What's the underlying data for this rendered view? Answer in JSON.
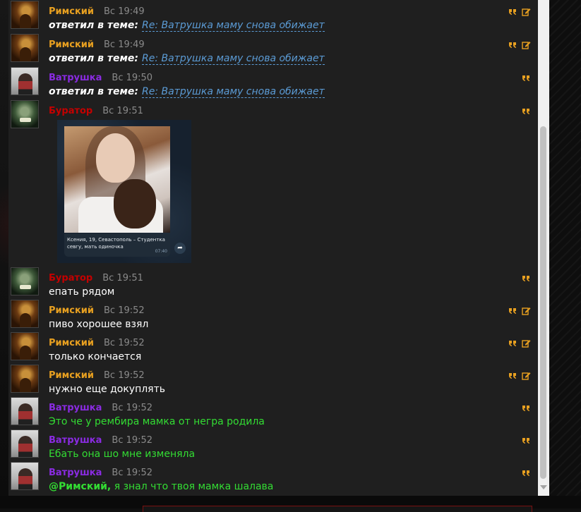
{
  "colors": {
    "rimsky": "#e8a020",
    "vatrushka": "#8a2be2",
    "burator": "#c40000",
    "time": "#8a8a8a",
    "link": "#5b9bd5",
    "green_text": "#33dd33",
    "panel_bg": "#1f1f1f"
  },
  "icons": {
    "quote": "quote-icon",
    "edit": "edit-icon",
    "share": "share-icon"
  },
  "messages": [
    {
      "author": "Римский",
      "time": "Вс 19:49",
      "topic_prefix": "ответил в теме:",
      "topic": "Re: Ватрушка маму снова обижает"
    },
    {
      "author": "Римский",
      "time": "Вс 19:49",
      "topic_prefix": "ответил в теме:",
      "topic": "Re: Ватрушка маму снова обижает"
    },
    {
      "author": "Ватрушка",
      "time": "Вс 19:50",
      "topic_prefix": "ответил в теме:",
      "topic": "Re: Ватрушка маму снова обижает"
    },
    {
      "author": "Буратор",
      "time": "Вс 19:51",
      "image_caption": "Ксения, 19, Севастополь – Студентка севгу, мать одиночка",
      "image_time": "07:40"
    },
    {
      "author": "Буратор",
      "time": "Вс 19:51",
      "text": "епать рядом"
    },
    {
      "author": "Римский",
      "time": "Вс 19:52",
      "text": "пиво хорошее взял"
    },
    {
      "author": "Римский",
      "time": "Вс 19:52",
      "text": "только кончается"
    },
    {
      "author": "Римский",
      "time": "Вс 19:52",
      "text": "нужно еще докуплять"
    },
    {
      "author": "Ватрушка",
      "time": "Вс 19:52",
      "text": "Это че у рембира мамка от негра родила"
    },
    {
      "author": "Ватрушка",
      "time": "Вс 19:52",
      "text": "Ебать она шо мне изменяла"
    },
    {
      "author": "Ватрушка",
      "time": "Вс 19:52",
      "mention": "@Римский,",
      "text": " я знал что твоя мамка шалава"
    }
  ]
}
